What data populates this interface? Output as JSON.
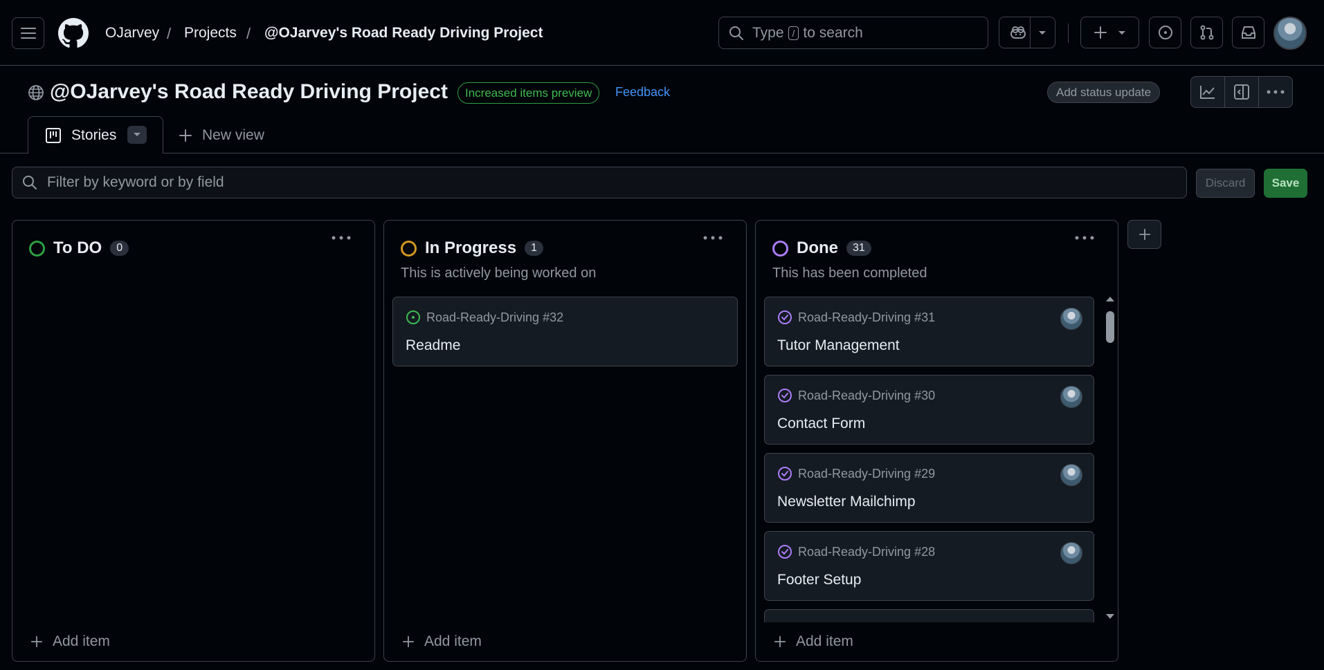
{
  "header": {
    "breadcrumbs": [
      "OJarvey",
      "Projects",
      "@OJarvey's Road Ready Driving Project"
    ],
    "search": {
      "prefix": "Type",
      "key": "/",
      "suffix": "to search"
    }
  },
  "project": {
    "title": "@OJarvey's Road Ready Driving Project",
    "preview_badge": "Increased items preview",
    "feedback": "Feedback",
    "status_update": "Add status update"
  },
  "tabs": {
    "active": "Stories",
    "new_view": "New view"
  },
  "filter": {
    "placeholder": "Filter by keyword or by field",
    "discard": "Discard",
    "save": "Save"
  },
  "columns": [
    {
      "name": "To DO",
      "count": "0",
      "description": "",
      "color": "#2ea043",
      "add_item": "Add item",
      "cards": []
    },
    {
      "name": "In Progress",
      "count": "1",
      "description": "This is actively being worked on",
      "color": "#d29922",
      "add_item": "Add item",
      "cards": [
        {
          "ref": "Road-Ready-Driving #32",
          "title": "Readme",
          "state": "open"
        }
      ]
    },
    {
      "name": "Done",
      "count": "31",
      "description": "This has been completed",
      "color": "#ab7df8",
      "add_item": "Add item",
      "cards": [
        {
          "ref": "Road-Ready-Driving #31",
          "title": "Tutor Management",
          "state": "closed"
        },
        {
          "ref": "Road-Ready-Driving #30",
          "title": "Contact Form",
          "state": "closed"
        },
        {
          "ref": "Road-Ready-Driving #29",
          "title": "Newsletter Mailchimp",
          "state": "closed"
        },
        {
          "ref": "Road-Ready-Driving #28",
          "title": "Footer Setup",
          "state": "closed"
        }
      ]
    }
  ],
  "colors": {
    "open": "#3fb950",
    "closed": "#ab7df8",
    "accent_link": "#4493f8",
    "save_bg": "#1f6f35"
  }
}
